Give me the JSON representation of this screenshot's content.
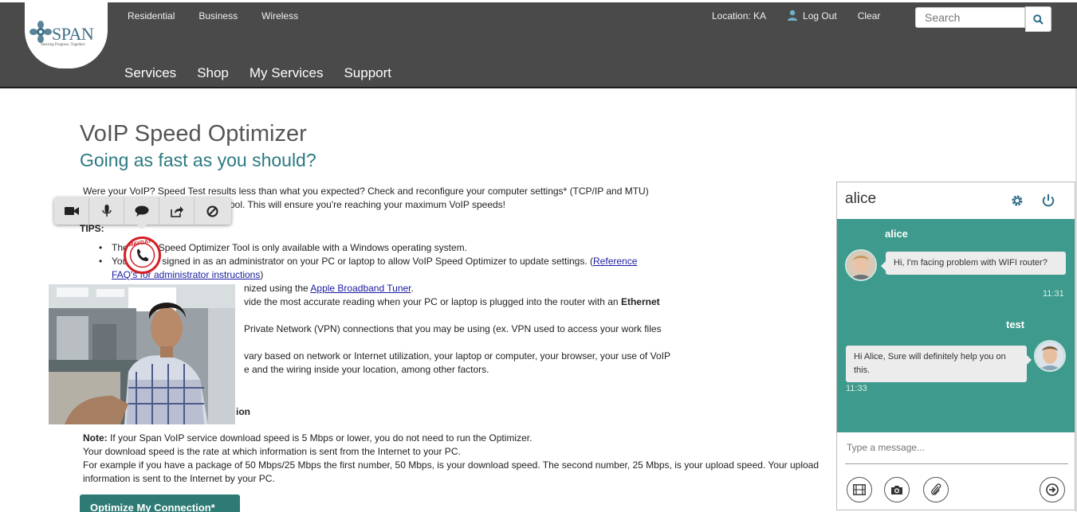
{
  "header": {
    "logo_text": "SPAN",
    "logo_tagline": "Steering Progress. Together.",
    "top_links": [
      "Residential",
      "Business",
      "Wireless"
    ],
    "location": "Location: KA",
    "logout": "Log Out",
    "clear": "Clear",
    "search_placeholder": "Search",
    "main_nav": [
      "Services",
      "Shop",
      "My Services",
      "Support"
    ]
  },
  "page": {
    "title": "VoIP Speed Optimizer",
    "subtitle": "Going as fast as you should?",
    "intro_line1": "Were your VoIP? Speed Test results less than what you expected? Check and reconfigure your computer settings* (TCP/IP and MTU)",
    "intro_line2": "ool. This will ensure you're reaching your maximum VoIP speeds!",
    "tips_label": "TIPS:",
    "bullets": [
      {
        "pre": "The",
        "text": "Speed Optimizer Tool is only available with a Windows operating system."
      },
      {
        "pre": "You",
        "text": "e signed in as an administrator on your PC or laptop to allow VoIP Speed Optimizer to update settings. (",
        "link": "Reference",
        "link2": "FAQ's for administrator instructions",
        "post": ")"
      },
      {
        "text": "nized using the ",
        "link": "Apple Broadband Tuner",
        "post": "."
      },
      {
        "text": "vide the most accurate reading when your PC or laptop is plugged into the router with an ",
        "bold": "Ethernet"
      },
      {
        "text": "Private Network (VPN) connections that you may be using (ex. VPN used to access your work files"
      },
      {
        "text": "vary based on network or Internet utilization, your laptop or computer, your browser, your use of VoIP",
        "line2": "e and the wiring inside your location, among other factors."
      }
    ],
    "partial_label": "ion",
    "note_label": "Note:",
    "note_text": " If your Span VoIP service download speed is 5 Mbps or lower, you do not need to run the Optimizer.",
    "note_line2": "Your download speed is the rate at which information is sent from the Internet to your PC.",
    "note_line3": "For example if you have a package of 50 Mbps/25 Mbps the first number, 50 Mbps, is your download speed. The second number, 25 Mbps, is your upload speed. Your upload",
    "note_line4": "information is sent to the Internet by your PC.",
    "optimize_button": "Optimize My Connection*"
  },
  "call_toolbar": {
    "icons": [
      "video-camera-icon",
      "microphone-icon",
      "chat-bubble-icon",
      "share-icon",
      "block-icon"
    ],
    "sticker_text": "MAYDAY"
  },
  "chat": {
    "contact_name": "alice",
    "messages": [
      {
        "sender": "alice",
        "text": "Hi, I'm facing problem with WIFI router?",
        "time": "11:31",
        "side": "left"
      },
      {
        "sender": "test",
        "text": "Hi Alice, Sure will definitely help you on this.",
        "time": "11:33",
        "side": "right"
      }
    ],
    "input_placeholder": "Type a message...",
    "colors": {
      "accent": "#3e9a8c",
      "header_bg": "#4a4a4a",
      "button": "#2e7b76"
    }
  }
}
